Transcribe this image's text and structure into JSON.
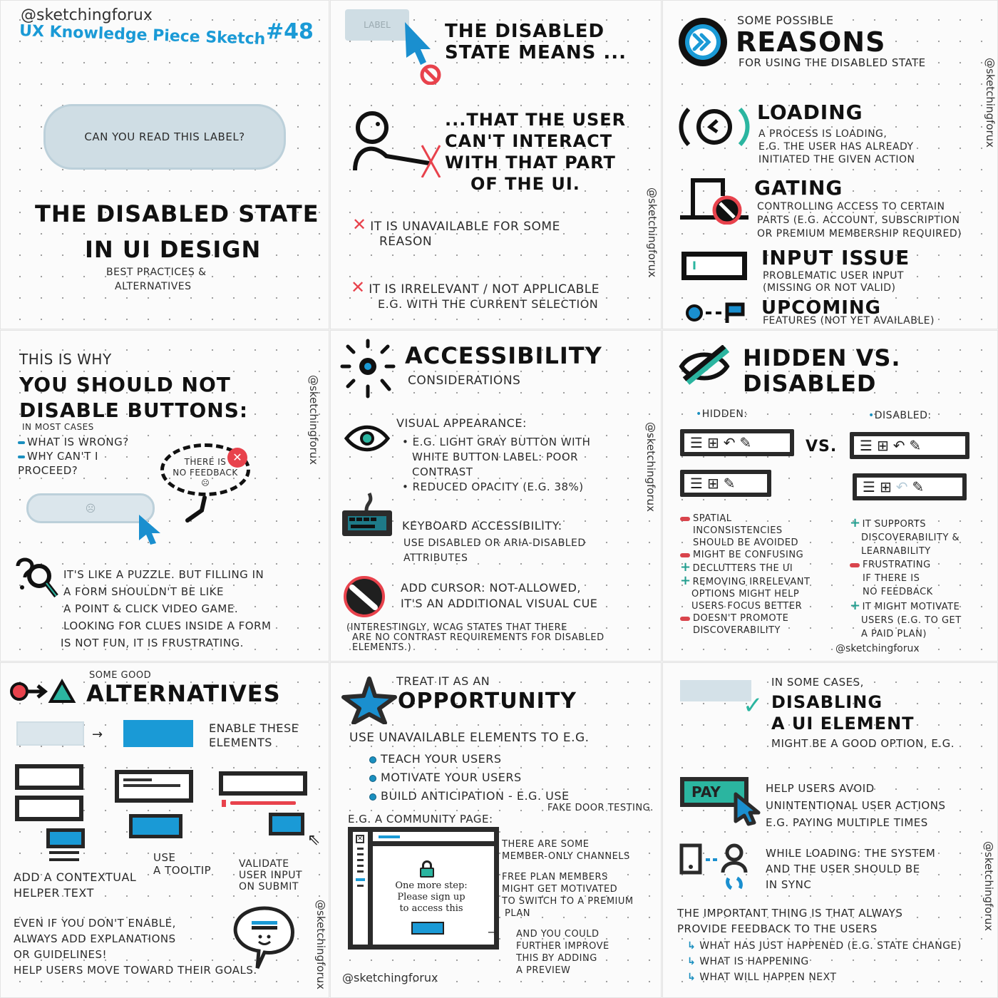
{
  "colors": {
    "accent_blue": "#1a9ad6",
    "teal": "#2bb5a0",
    "red": "#e8424c",
    "ink": "#1a1a1a",
    "disabled_gray": "#cfdde4"
  },
  "handle": "@sketchingforux",
  "panels": {
    "title": {
      "handle": "@sketchingforux",
      "series": "UX Knowledge Piece Sketch",
      "number": "#48",
      "pill_label": "CAN YOU READ THIS LABEL?",
      "heading_line1": "THE DISABLED STATE",
      "heading_line2": "IN UI DESIGN",
      "subtitle_line1": "BEST PRACTICES &",
      "subtitle_line2": "ALTERNATIVES"
    },
    "means": {
      "button_label": "LABEL",
      "heading_line1": "THE DISABLED",
      "heading_line2": "STATE MEANS ...",
      "statement_lines": [
        "...THAT THE USER",
        "CAN'T INTERACT",
        "WITH THAT PART",
        "OF THE UI."
      ],
      "items": [
        {
          "icon": "x-icon",
          "lines": [
            "IT IS UNAVAILABLE FOR SOME",
            "REASON"
          ]
        },
        {
          "icon": "x-icon",
          "lines": [
            "IT IS IRRELEVANT / NOT APPLICABLE",
            "E.G. WITH THE CURRENT SELECTION"
          ]
        }
      ],
      "handle": "@sketchingforux"
    },
    "reasons": {
      "kicker": "SOME POSSIBLE",
      "heading": "REASONS",
      "subheading": "FOR USING THE DISABLED STATE",
      "handle": "@sketchingforux",
      "items": [
        {
          "icon": "loading-clock-icon",
          "title": "LOADING",
          "lines": [
            "A PROCESS IS LOADING,",
            "E.G. THE USER HAS ALREADY",
            "INITIATED THE GIVEN ACTION"
          ]
        },
        {
          "icon": "gate-door-icon",
          "title": "GATING",
          "lines": [
            "CONTROLLING ACCESS TO CERTAIN",
            "PARTS (E.G. ACCOUNT, SUBSCRIPTION",
            "OR PREMIUM MEMBERSHIP REQUIRED)"
          ]
        },
        {
          "icon": "input-field-icon",
          "title": "INPUT ISSUE",
          "lines": [
            "PROBLEMATIC USER INPUT",
            "(MISSING OR NOT VALID)"
          ]
        },
        {
          "icon": "upcoming-flag-icon",
          "title": "UPCOMING",
          "lines": [
            "FEATURES (NOT YET AVAILABLE)"
          ]
        }
      ]
    },
    "why_not": {
      "kicker": "THIS IS WHY",
      "heading_line1": "YOU SHOULD NOT",
      "heading_line2": "DISABLE BUTTONS:",
      "qualifier": "IN MOST CASES",
      "questions": [
        "WHAT IS WRONG?",
        "WHY CAN'T I PROCEED?"
      ],
      "bubble_lines": [
        "THERE IS",
        "NO FEEDBACK"
      ],
      "puzzle_lines": [
        "IT'S LIKE A PUZZLE. BUT FILLING IN",
        "A FORM SHOULDN'T BE LIKE",
        "A POINT & CLICK VIDEO GAME.",
        "LOOKING FOR CLUES INSIDE A FORM",
        "IS NOT FUN, IT IS FRUSTRATING."
      ],
      "handle": "@sketchingforux"
    },
    "accessibility": {
      "heading": "ACCESSIBILITY",
      "subheading": "CONSIDERATIONS",
      "handle": "@sketchingforux",
      "visual_title": "VISUAL APPEARANCE:",
      "visual_bullets": [
        [
          "E.G. LIGHT GRAY BUTTON WITH",
          "WHITE BUTTON LABEL: POOR",
          "CONTRAST"
        ],
        [
          "REDUCED OPACITY (E.G. 38%)"
        ]
      ],
      "keyboard_title": "KEYBOARD ACCESSIBILITY:",
      "keyboard_lines": [
        "USE DISABLED OR ARIA-DISABLED",
        "ATTRIBUTES"
      ],
      "cursor_lines": [
        "ADD CURSOR: NOT-ALLOWED,",
        "IT'S AN ADDITIONAL VISUAL CUE"
      ],
      "note_lines": [
        "(INTERESTINGLY, WCAG STATES THAT THERE",
        "ARE NO CONTRAST REQUIREMENTS FOR DISABLED",
        "ELEMENTS.)"
      ]
    },
    "hidden_vs_disabled": {
      "heading_line1": "HIDDEN VS.",
      "heading_line2": "DISABLED",
      "hidden_label": "HIDDEN:",
      "disabled_label": "DISABLED:",
      "vs": "VS.",
      "toolbar_full": [
        "list-icon",
        "table-icon",
        "undo-icon",
        "edit-icon"
      ],
      "toolbar_hidden": [
        "list-icon",
        "table-icon",
        "edit-icon"
      ],
      "hidden_points": [
        {
          "type": "minus",
          "lines": [
            "SPATIAL",
            "INCONSISTENCIES",
            "SHOULD BE AVOIDED"
          ]
        },
        {
          "type": "minus",
          "lines": [
            "MIGHT BE CONFUSING"
          ]
        },
        {
          "type": "plus",
          "lines": [
            "DECLUTTERS THE UI"
          ]
        },
        {
          "type": "plus",
          "lines": [
            "REMOVING IRRELEVANT",
            "OPTIONS MIGHT HELP",
            "USERS FOCUS BETTER"
          ]
        },
        {
          "type": "minus",
          "lines": [
            "DOESN'T PROMOTE",
            "DISCOVERABILITY"
          ]
        }
      ],
      "disabled_points": [
        {
          "type": "plus",
          "lines": [
            "IT SUPPORTS",
            "DISCOVERABILITY &",
            "LEARNABILITY"
          ]
        },
        {
          "type": "minus",
          "lines": [
            "FRUSTRATING",
            "IF THERE IS",
            "NO FEEDBACK"
          ]
        },
        {
          "type": "plus",
          "lines": [
            "IT MIGHT MOTIVATE",
            "USERS (E.G. TO GET",
            "A PAID PLAN)"
          ]
        }
      ],
      "handle": "@sketchingforux"
    },
    "alternatives": {
      "kicker": "SOME GOOD",
      "heading": "ALTERNATIVES",
      "enable_lines": [
        "ENABLE THESE",
        "ELEMENTS"
      ],
      "helper_lines": [
        "ADD A CONTEXTUAL",
        "HELPER TEXT"
      ],
      "tooltip_lines": [
        "USE",
        "A TOOLTIP"
      ],
      "validate_lines": [
        "VALIDATE",
        "USER INPUT",
        "ON SUBMIT"
      ],
      "footer_lines": [
        "EVEN IF YOU DON'T ENABLE,",
        "ALWAYS ADD EXPLANATIONS",
        "OR GUIDELINES!",
        "HELP USERS MOVE TOWARD THEIR GOALS."
      ],
      "handle": "@sketchingforux"
    },
    "opportunity": {
      "kicker": "TREAT IT AS AN",
      "heading": "OPPORTUNITY",
      "intro": "USE UNAVAILABLE ELEMENTS TO E.G.",
      "bullets": [
        "TEACH YOUR USERS",
        "MOTIVATE YOUR USERS",
        "BUILD ANTICIPATION - E.G. USE"
      ],
      "bullet_note": "FAKE DOOR TESTING.",
      "example_label": "E.G. A COMMUNITY PAGE:",
      "mock_lines": [
        "One more step:",
        "Please sign up",
        "to access this"
      ],
      "side_notes": [
        [
          "THERE ARE SOME",
          "MEMBER-ONLY CHANNELS"
        ],
        [
          "FREE PLAN MEMBERS",
          "MIGHT GET MOTIVATED",
          "TO SWITCH TO A PREMIUM",
          "PLAN"
        ],
        [
          "AND YOU COULD",
          "FURTHER IMPROVE",
          "THIS BY ADDING",
          "A PREVIEW"
        ]
      ],
      "handle": "@sketchingforux"
    },
    "good_option": {
      "kicker": "IN SOME CASES,",
      "heading_line1": "DISABLING",
      "heading_line2": "A UI ELEMENT",
      "subheading": "MIGHT BE A GOOD OPTION, E.G.",
      "pay_label": "PAY",
      "pay_lines": [
        "HELP USERS AVOID",
        "UNINTENTIONAL USER ACTIONS",
        "E.G. PAYING MULTIPLE TIMES"
      ],
      "sync_lines": [
        "WHILE LOADING: THE SYSTEM",
        "AND THE USER SHOULD BE",
        "IN SYNC"
      ],
      "important_lines": [
        "THE IMPORTANT THING IS THAT ALWAYS",
        "PROVIDE FEEDBACK TO THE USERS"
      ],
      "feedback_points": [
        "WHAT HAS JUST HAPPENED (E.G. STATE CHANGE)",
        "WHAT IS HAPPENING",
        "WHAT WILL HAPPEN NEXT"
      ],
      "handle": "@sketchingforux"
    }
  }
}
